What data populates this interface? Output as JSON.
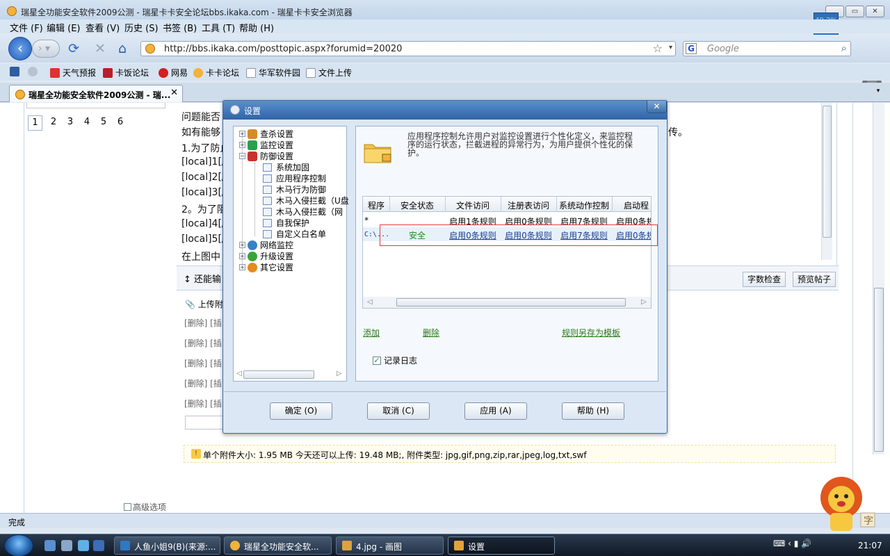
{
  "window": {
    "title": "瑞星全功能安全软件2009公测 - 瑞星卡卡安全论坛bbs.ikaka.com - 瑞星卡卡安全浏览器",
    "cpu_meter": "49.2%"
  },
  "menu": [
    "文件 (F)",
    "编辑 (E)",
    "查看 (V)",
    "历史 (S)",
    "书签 (B)",
    "工具 (T)",
    "帮助 (H)"
  ],
  "nav": {
    "url": "http://bbs.ikaka.com/posttopic.aspx?forumid=20020",
    "search_placeholder": "Google"
  },
  "bookmarks": [
    "天气预报",
    "卡饭论坛",
    "网易",
    "卡卡论坛",
    "华军软件园",
    "文件上传"
  ],
  "tab": {
    "title": "瑞星全功能安全软件2009公测 - 瑞..."
  },
  "page": {
    "pager": [
      "1",
      "2",
      "3",
      "4",
      "5",
      "6"
    ],
    "lines": [
      "问题能否",
      "如有能够",
      "1.为了防止",
      "[local]1[/",
      "[local]2[/",
      "[local]3[/",
      "2。为了阻",
      "[local]4[/",
      "[local]5[/",
      "在上图中"
    ],
    "line_right": "传。",
    "hint": "还能输",
    "btn_wordcount": "字数检查",
    "btn_preview": "预览帖子",
    "attach_label": "上传附",
    "del_rows": [
      "[删除] [插",
      "[删除] [插",
      "[删除] [插",
      "[删除] [插",
      "[删除] [插"
    ],
    "upload_info": "单个附件大小: 1.95 MB  今天还可以上传: 19.48 MB;,  附件类型:  jpg,gif,png,zip,rar,jpeg,log,txt,swf",
    "advanced": "高级选项"
  },
  "status": {
    "text": "完成"
  },
  "dialog": {
    "title": "设置",
    "tree": [
      {
        "label": "查杀设置",
        "level": 0,
        "expander": "+"
      },
      {
        "label": "监控设置",
        "level": 0,
        "expander": "+"
      },
      {
        "label": "防御设置",
        "level": 0,
        "expander": "-"
      },
      {
        "label": "系统加固",
        "level": 1
      },
      {
        "label": "应用程序控制",
        "level": 1
      },
      {
        "label": "木马行为防御",
        "level": 1
      },
      {
        "label": "木马入侵拦截（U盘",
        "level": 1
      },
      {
        "label": "木马入侵拦截（网",
        "level": 1
      },
      {
        "label": "自我保护",
        "level": 1
      },
      {
        "label": "自定义白名单",
        "level": 1
      },
      {
        "label": "网络监控",
        "level": 0,
        "expander": "+"
      },
      {
        "label": "升级设置",
        "level": 0,
        "expander": "+"
      },
      {
        "label": "其它设置",
        "level": 0,
        "expander": "+"
      }
    ],
    "description": "应用程序控制允许用户对监控设置进行个性化定义，来监控程序的运行状态，拦截进程的异常行为，为用户提供个性化的保护。",
    "columns": [
      "程序",
      "安全状态",
      "文件访问",
      "注册表访问",
      "系统动作控制",
      "启动程"
    ],
    "rows": [
      [
        "*",
        "",
        "启用1条规则",
        "启用0条规则",
        "启用7条规则",
        "启用0条规"
      ],
      [
        "C:\\...",
        "安全",
        "启用0条规则",
        "启用0条规则",
        "启用7条规则",
        "启用0条规"
      ]
    ],
    "link_add": "添加",
    "link_delete": "删除",
    "link_save_template": "规则另存为模板",
    "log_checkbox": "记录日志",
    "btn_ok": "确定 (O)",
    "btn_cancel": "取消 (C)",
    "btn_apply": "应用 (A)",
    "btn_help": "帮助 (H)"
  },
  "taskbar": {
    "buttons": [
      "人鱼小姐9(B)(来源:...",
      "瑞星全功能安全软...",
      "4.jpg - 画图",
      "设置"
    ],
    "clock": "21:07"
  }
}
